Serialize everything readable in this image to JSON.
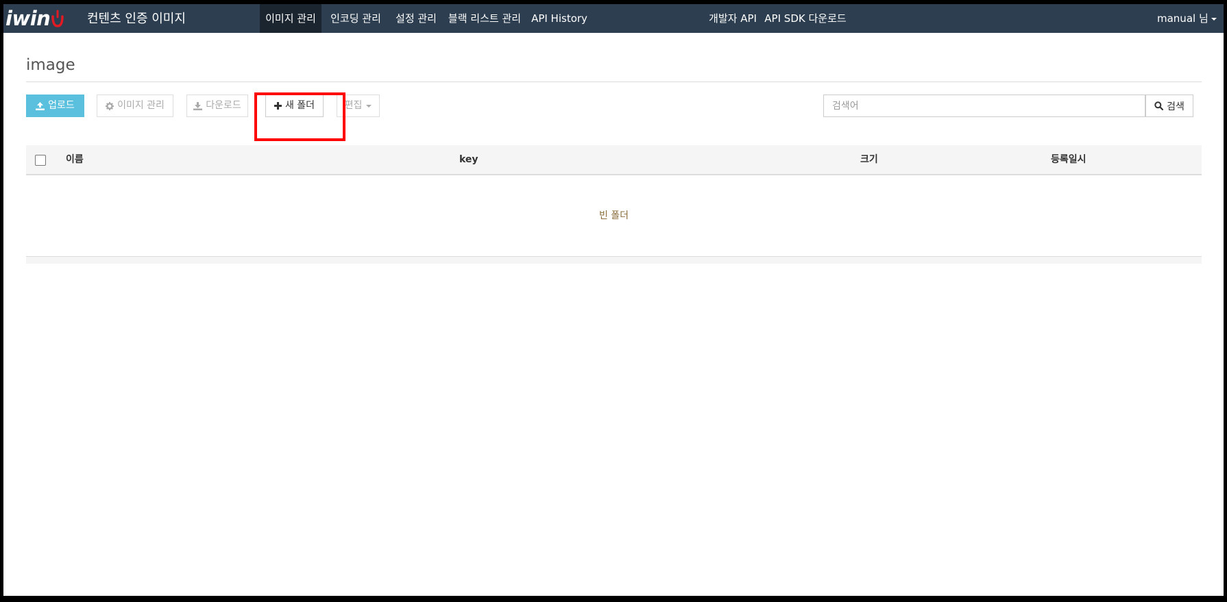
{
  "navbar": {
    "logo_text": "iwin",
    "brand": "컨텐츠 인증 이미지",
    "items": [
      {
        "label": "이미지 관리",
        "active": true
      },
      {
        "label": "인코딩 관리",
        "active": false
      },
      {
        "label": "설정 관리",
        "active": false
      },
      {
        "label": "블랙 리스트 관리",
        "active": false
      },
      {
        "label": "API History",
        "active": false
      },
      {
        "label": "개발자 API",
        "active": false
      },
      {
        "label": "API SDK 다운로드",
        "active": false
      }
    ],
    "user": "manual 님"
  },
  "page": {
    "title": "image"
  },
  "toolbar": {
    "upload_label": "업로드",
    "manage_label": "이미지 관리",
    "download_label": "다운로드",
    "new_folder_label": "새 폴더",
    "edit_label": "편집",
    "search_placeholder": "검색어",
    "search_label": "검색"
  },
  "table": {
    "columns": [
      "이름",
      "key",
      "크기",
      "등록일시"
    ],
    "empty_text": "빈 폴더"
  },
  "colors": {
    "navbar": "#2c3e50",
    "navbar_active": "#1a2530",
    "primary": "#5bc0de",
    "highlight": "#ff0000",
    "empty_text": "#8a6d3b",
    "logo_accent": "#e01b24"
  },
  "icons": {
    "upload": "upload-icon",
    "manage": "gear-icon",
    "download": "download-icon",
    "new_folder": "plus-icon",
    "search": "search-icon",
    "logo": "smile-icon"
  }
}
